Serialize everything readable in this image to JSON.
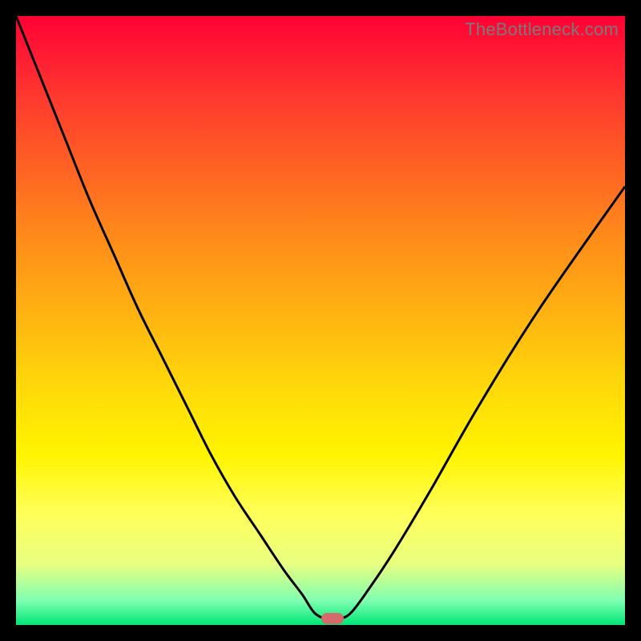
{
  "watermark": "TheBottleneck.com",
  "colors": {
    "curve_stroke": "#000000",
    "marker_fill": "#d46a6a",
    "frame_bg": "#000000"
  },
  "chart_data": {
    "type": "line",
    "title": "",
    "xlabel": "",
    "ylabel": "",
    "xlim": [
      0,
      100
    ],
    "ylim": [
      0,
      100
    ],
    "series": [
      {
        "name": "bottleneck-curve",
        "x": [
          0,
          4,
          8,
          12,
          16,
          20,
          24,
          28,
          32,
          36,
          40,
          44,
          47,
          49,
          51,
          53,
          55,
          58,
          62,
          68,
          76,
          86,
          100
        ],
        "y": [
          100,
          90,
          80,
          70,
          61,
          52,
          44,
          36,
          28,
          21,
          15,
          9,
          5,
          2,
          1,
          1,
          2,
          6,
          12,
          22,
          36,
          52,
          72
        ]
      }
    ],
    "annotations": [
      {
        "name": "optimum-marker",
        "x": 52,
        "y": 1
      }
    ]
  }
}
